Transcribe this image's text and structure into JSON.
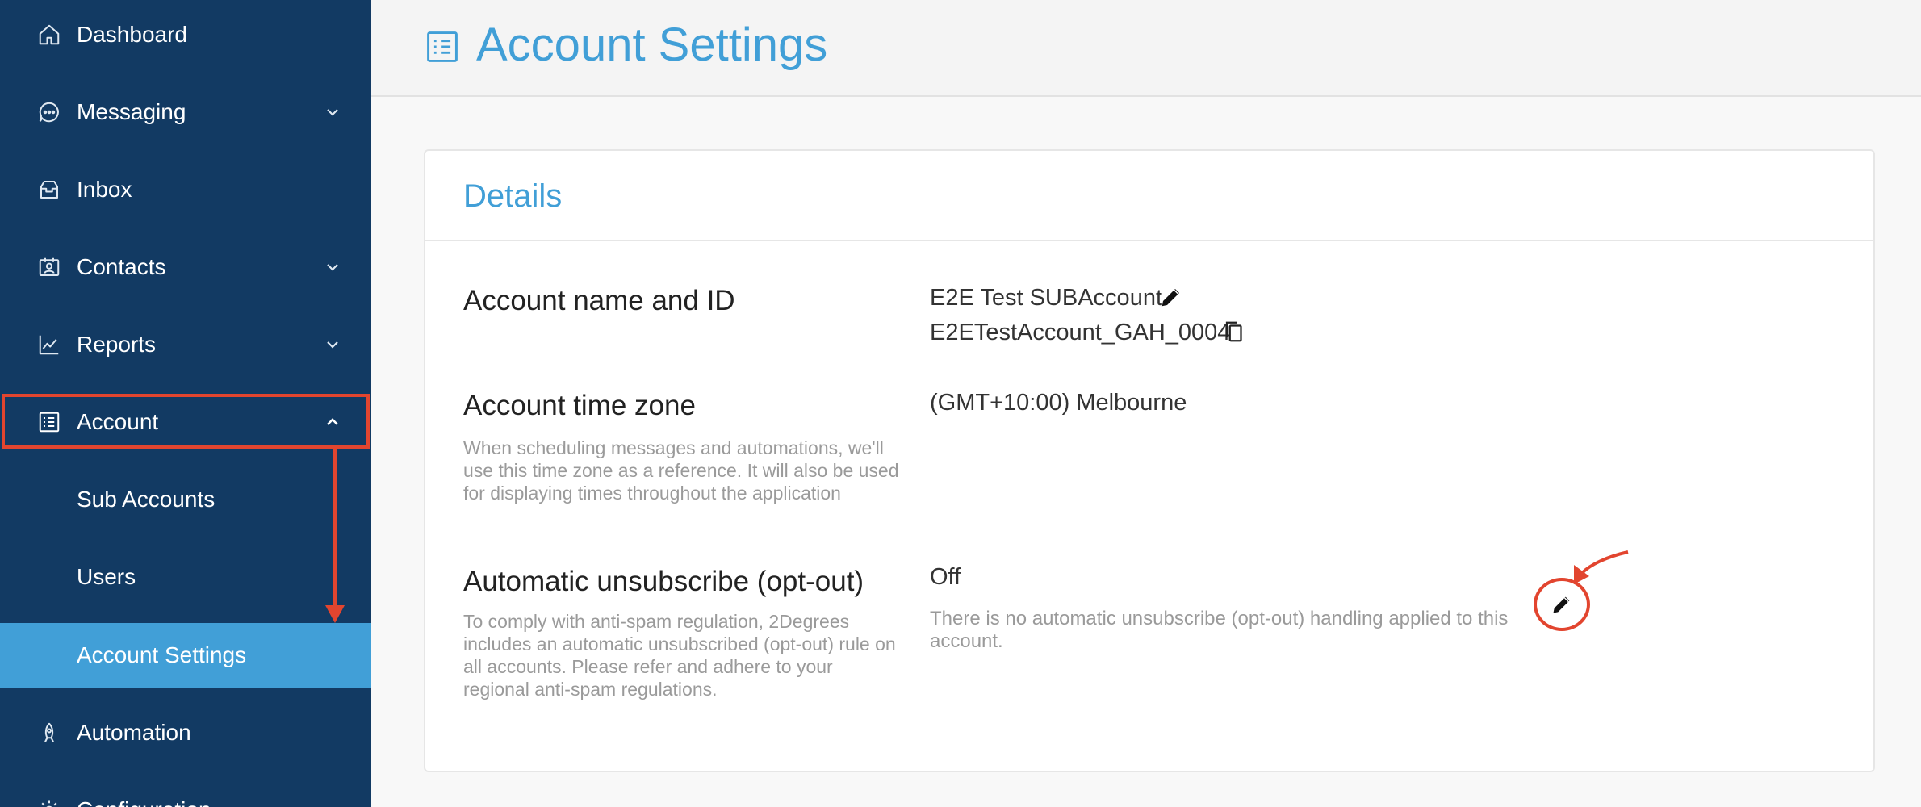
{
  "sidebar": {
    "items": [
      {
        "label": "Dashboard",
        "icon": "home-icon"
      },
      {
        "label": "Messaging",
        "icon": "chat-icon"
      },
      {
        "label": "Inbox",
        "icon": "inbox-icon"
      },
      {
        "label": "Contacts",
        "icon": "contacts-icon"
      },
      {
        "label": "Reports",
        "icon": "chart-icon"
      },
      {
        "label": "Account",
        "icon": "list-icon"
      },
      {
        "label": "Sub Accounts"
      },
      {
        "label": "Users"
      },
      {
        "label": "Account Settings"
      },
      {
        "label": "Automation",
        "icon": "automation-icon"
      },
      {
        "label": "Configuration",
        "icon": "gear-icon"
      }
    ]
  },
  "header": {
    "title": "Account Settings"
  },
  "details": {
    "title": "Details",
    "account_name": {
      "label": "Account name and ID",
      "name": "E2E Test SUBAccount",
      "id": "E2ETestAccount_GAH_0004"
    },
    "time_zone": {
      "label": "Account time zone",
      "description": "When scheduling messages and automations, we'll use this time zone as a reference. It will also be used for displaying times throughout the application",
      "value": "(GMT+10:00) Melbourne"
    },
    "opt_out": {
      "label": "Automatic unsubscribe (opt-out)",
      "description": "To comply with anti-spam regulation, 2Degrees includes an automatic unsubscribed (opt-out) rule on all accounts. Please refer and adhere to your regional anti-spam regulations.",
      "value": "Off",
      "value_description": "There is no automatic unsubscribe (opt-out) handling applied to this account."
    }
  },
  "colors": {
    "sidebar_bg": "#123a63",
    "accent": "#419fd7",
    "annotation": "#e2452f"
  }
}
